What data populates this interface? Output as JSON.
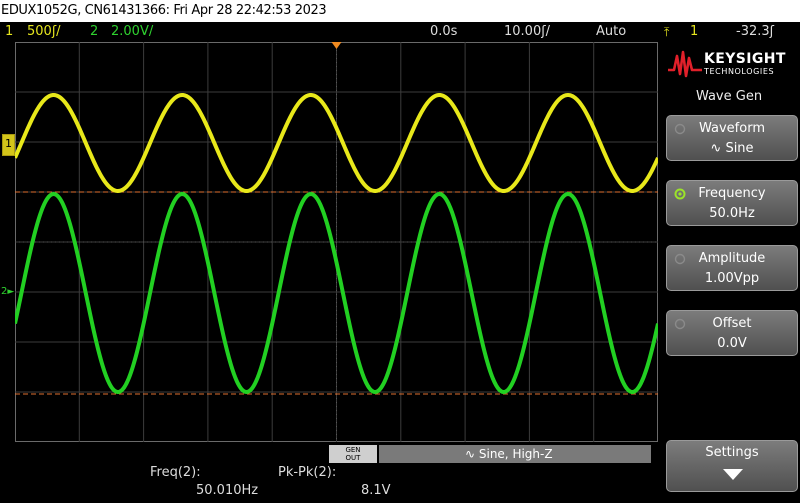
{
  "titlebar": {
    "text": "EDUX1052G, CN61431366: Fri Apr 28 22:42:53 2023"
  },
  "status": {
    "ch1_num": "1",
    "ch1_scale": "500ʃ/",
    "ch2_num": "2",
    "ch2_scale": "2.00V/",
    "time_delay": "0.0s",
    "timebase": "10.00ʃ/",
    "trigger_mode": "Auto",
    "trig_source": "1",
    "trig_level": "-32.3ʃ"
  },
  "screen": {
    "ch1_marker": "1",
    "ch2_marker": "2",
    "trace_colors": {
      "ch1": "#e8e81a",
      "ch2": "#22d022",
      "grid": "#3c3c3c",
      "ref_line": "#e07030"
    }
  },
  "brand": {
    "name": "KEYSIGHT",
    "sub": "TECHNOLOGIES"
  },
  "panel": {
    "title": "Wave Gen",
    "softkeys": [
      {
        "label": "Waveform",
        "value": "∿ Sine"
      },
      {
        "label": "Frequency",
        "value": "50.0Hz"
      },
      {
        "label": "Amplitude",
        "value": "1.00Vpp"
      },
      {
        "label": "Offset",
        "value": "0.0V"
      }
    ],
    "settings": {
      "label": "Settings"
    }
  },
  "wavegen_bar": {
    "gen_out_top": "GEN",
    "gen_out_bottom": "OUT",
    "text": "∿  Sine, High-Z"
  },
  "measurements": {
    "freq_label": "Freq(2):",
    "freq_value": "50.010Hz",
    "pkpk_label": "Pk-Pk(2):",
    "pkpk_value": "8.1V"
  }
}
